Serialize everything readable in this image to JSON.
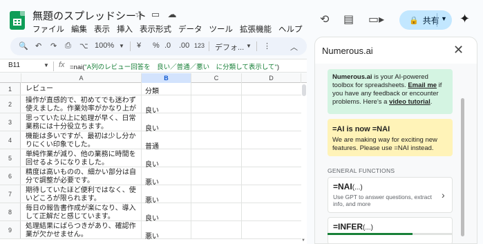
{
  "app": {
    "doc_title": "無題のスプレッドシート",
    "menu": [
      "ファイル",
      "編集",
      "表示",
      "挿入",
      "表示形式",
      "データ",
      "ツール",
      "拡張機能",
      "ヘルプ"
    ],
    "share_label": "共有"
  },
  "toolbar": {
    "zoom": "100%",
    "currency": "¥",
    "percent": "%",
    "dec_decrease": ".0",
    "dec_increase": ".00",
    "number_format": "123",
    "font": "デフォ..."
  },
  "formula_bar": {
    "cell_ref": "B11",
    "fx": "fx",
    "formula_fn": "=nai(",
    "formula_str": "\"A列のレビュー回答を　良い／普通／悪い　に分類して表示して\"",
    "formula_close": ")"
  },
  "columns": [
    "A",
    "B",
    "C",
    "D"
  ],
  "rows": [
    {
      "num": "1",
      "a": "レビュー",
      "b": "分類"
    },
    {
      "num": "2",
      "a": "操作が直感的で、初めてでも迷わず使えました。作業効率がかなり上がります。",
      "b": "良い"
    },
    {
      "num": "3",
      "a": "思っていた以上に処理が早く、日常業務には十分役立ちます。",
      "b": "良い"
    },
    {
      "num": "4",
      "a": "機能は多いですが、最初は少し分かりにくい印象でした。",
      "b": "普通"
    },
    {
      "num": "5",
      "a": "単純作業が減り、他の業務に時間を回せるようになりました。",
      "b": "良い"
    },
    {
      "num": "6",
      "a": "精度は高いものの、細かい部分は自分で調整が必要です。",
      "b": "悪い"
    },
    {
      "num": "7",
      "a": "期待していたほど便利ではなく、使いどころが限られます。",
      "b": "悪い"
    },
    {
      "num": "8",
      "a": "毎日の報告書作成が楽になり、導入して正解だと感じています。",
      "b": "良い"
    },
    {
      "num": "9",
      "a": "処理結果にばらつきがあり、確認作業が欠かせません。",
      "b": "悪い"
    }
  ],
  "panel": {
    "title": "Numerous.ai",
    "intro_brand": "Numerous.ai",
    "intro_text1": " is your AI-powered toolbox for spreadsheets. ",
    "intro_email": "Email me",
    "intro_text2": " if you have any feedback or encounter problems. Here's a ",
    "intro_video": "video tutorial",
    "intro_end": ".",
    "notice_title": "=AI is now =NAI",
    "notice_text": "We are making way for exciting new features. Please use =NAI instead.",
    "section_label": "GENERAL FUNCTIONS",
    "fn1_name": "=NAI",
    "fn1_args": "(...)",
    "fn1_desc": "Use GPT to answer questions, extract info, and more",
    "fn2_name": "=INFER",
    "fn2_args": "(...)",
    "progress": 0.68,
    "colors": {
      "green_card": "#d4f4e2",
      "yellow_card": "#fff3b8",
      "progress": "#188038"
    }
  }
}
